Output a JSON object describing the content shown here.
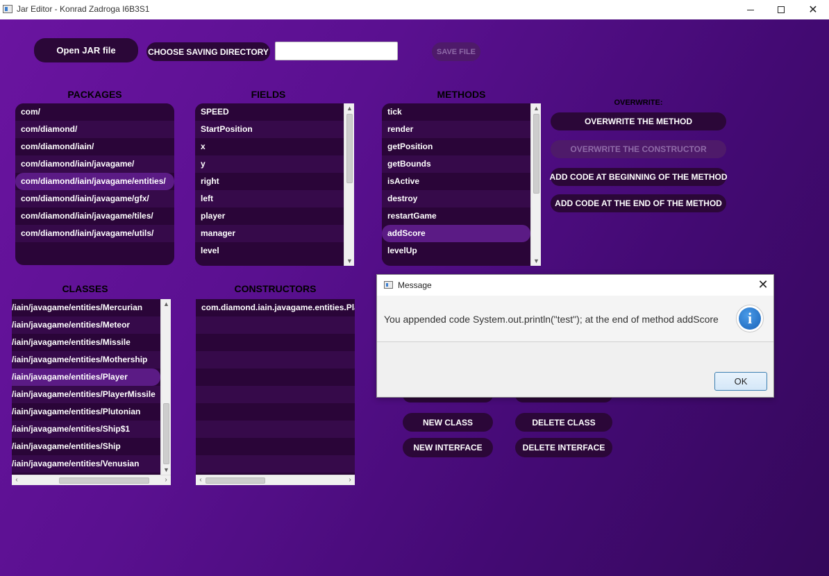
{
  "window": {
    "title": "Jar Editor - Konrad Zadroga I6B3S1"
  },
  "toolbar": {
    "open_jar": "Open JAR file",
    "choose_dir": "CHOOSE SAVING DIRECTORY",
    "save_dir_value": "",
    "save_file": "SAVE FILE"
  },
  "headings": {
    "packages": "PACKAGES",
    "fields": "FIELDS",
    "methods": "METHODS",
    "classes": "CLASSES",
    "constructors": "CONSTRUCTORS",
    "overwrite": "OVERWRITE:"
  },
  "packages": [
    "com/",
    "com/diamond/",
    "com/diamond/iain/",
    "com/diamond/iain/javagame/",
    "com/diamond/iain/javagame/entities/",
    "com/diamond/iain/javagame/gfx/",
    "com/diamond/iain/javagame/tiles/",
    "com/diamond/iain/javagame/utils/"
  ],
  "fields": [
    "SPEED",
    "StartPosition",
    "x",
    "y",
    "right",
    "left",
    "player",
    "manager",
    "level"
  ],
  "methods": [
    "tick",
    "render",
    "getPosition",
    "getBounds",
    "isActive",
    "destroy",
    "restartGame",
    "addScore",
    "levelUp"
  ],
  "classes": [
    "/iain/javagame/entities/Mercurian",
    "/iain/javagame/entities/Meteor",
    "/iain/javagame/entities/Missile",
    "/iain/javagame/entities/Mothership",
    "/iain/javagame/entities/Player",
    "/iain/javagame/entities/PlayerMissile",
    "/iain/javagame/entities/Plutonian",
    "/iain/javagame/entities/Ship$1",
    "/iain/javagame/entities/Ship",
    "/iain/javagame/entities/Venusian"
  ],
  "constructors": [
    "com.diamond.iain.javagame.entities.Play"
  ],
  "overwrite_actions": {
    "overwrite_method": "OVERWRITE THE METHOD",
    "overwrite_constructor": "OVERWRITE THE CONSTRUCTOR",
    "add_beginning": "ADD CODE AT BEGINNING OF THE METHOD",
    "add_end": "ADD CODE AT THE END OF THE METHOD"
  },
  "class_actions": {
    "new_class": "NEW CLASS",
    "delete_class": "DELETE CLASS",
    "new_interface": "NEW INTERFACE",
    "delete_interface": "DELETE INTERFACE"
  },
  "dialog": {
    "title": "Message",
    "message": "You appended code System.out.println(\"test\"); at the end of method addScore",
    "ok": "OK",
    "icon_glyph": "i"
  },
  "colors": {
    "background_start": "#6a14a0",
    "background_end": "#34085a",
    "button": "#2b0738",
    "list_selected": "#5b1b85"
  }
}
